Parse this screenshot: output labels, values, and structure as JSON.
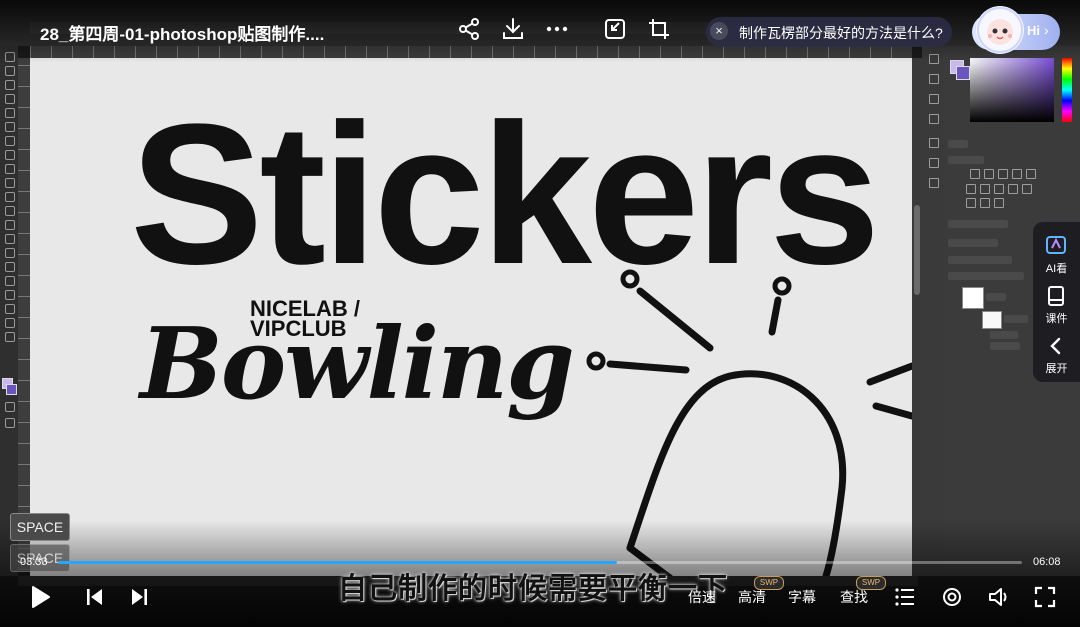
{
  "video": {
    "title": "28_第四周-01-photoshop贴图制作....",
    "current_time": "03:33",
    "duration": "06:08",
    "progress": 0.58,
    "subtitle": "自己制作的时候需要平衡一下"
  },
  "ai_banner": {
    "close_glyph": "×",
    "question": "制作瓦楞部分最好的方法是什么?"
  },
  "assistant": {
    "greeting": "Hi",
    "chevron": "›"
  },
  "side_panel": {
    "items": [
      {
        "label": "AI看",
        "icon": "ai-look-icon"
      },
      {
        "label": "课件",
        "icon": "courseware-icon"
      },
      {
        "label": "展开",
        "icon": "expand-chevron-icon"
      }
    ]
  },
  "canvas_text": {
    "headline": "Stickers",
    "brand_line1": "NICELAB /",
    "brand_line2": "VIPCLUB",
    "script_word": "Bowling"
  },
  "keystroke_badges": [
    "SPACE",
    "SPACE"
  ],
  "controls": {
    "speed_label": "倍速",
    "quality_label": "高清",
    "subtitle_label": "字幕",
    "search_label": "查找",
    "swp_badge": "SWP"
  },
  "colors": {
    "accent": "#2aa6ff",
    "fg_swatch": "#c7b9ee",
    "bg_swatch": "#6b55c0"
  }
}
